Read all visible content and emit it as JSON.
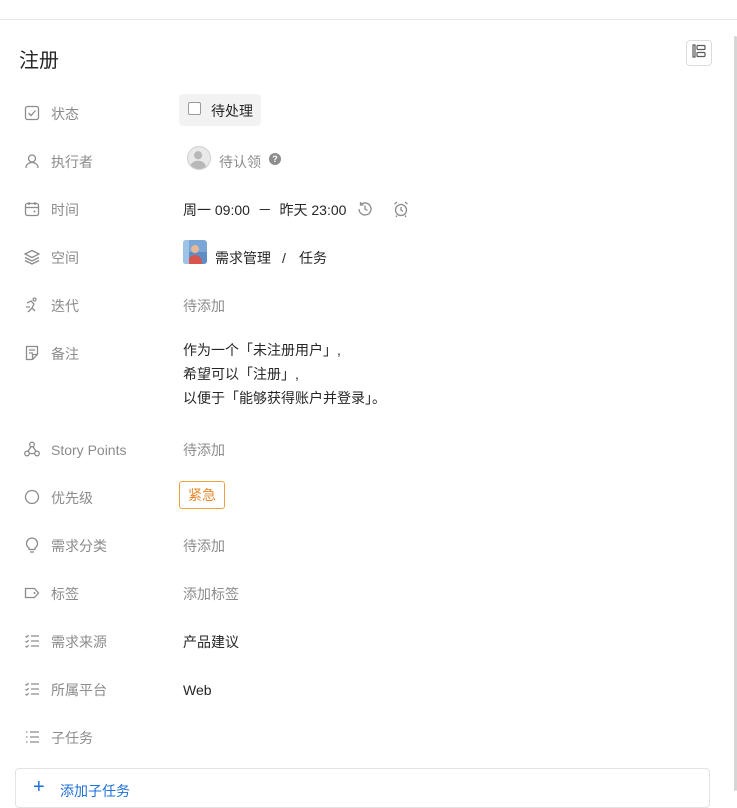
{
  "title": "注册",
  "fields": {
    "status": {
      "label": "状态",
      "value": "待处理"
    },
    "assignee": {
      "label": "执行者",
      "value": "待认领",
      "help": "?"
    },
    "time": {
      "label": "时间",
      "value": "周一 09:00  －  昨天 23:00"
    },
    "space": {
      "label": "空间",
      "project": "需求管理",
      "separator": "/",
      "module": "任务"
    },
    "iteration": {
      "label": "迭代",
      "value": "待添加"
    },
    "note": {
      "label": "备注",
      "lines": [
        "作为一个「未注册用户」,",
        "希望可以「注册」,",
        "以便于「能够获得账户并登录」。"
      ]
    },
    "story_points": {
      "label": "Story Points",
      "value": "待添加"
    },
    "priority": {
      "label": "优先级",
      "value": "紧急",
      "color": "#e8892d"
    },
    "category": {
      "label": "需求分类",
      "value": "待添加"
    },
    "tags": {
      "label": "标签",
      "value": "添加标签"
    },
    "source": {
      "label": "需求来源",
      "value": "产品建议"
    },
    "platform": {
      "label": "所属平台",
      "value": "Web"
    },
    "subtasks": {
      "label": "子任务"
    }
  },
  "add_subtask": {
    "label": "添加子任务"
  },
  "icons": [
    "layout-icon",
    "checkbox-icon",
    "user-icon",
    "calendar-icon",
    "history-icon",
    "alarm-icon",
    "layers-icon",
    "run-icon",
    "note-icon",
    "graph-icon",
    "circle-icon",
    "bulb-icon",
    "tag-icon",
    "checklist-icon",
    "list-icon",
    "plus-icon"
  ],
  "accent": "#1e6fd9"
}
